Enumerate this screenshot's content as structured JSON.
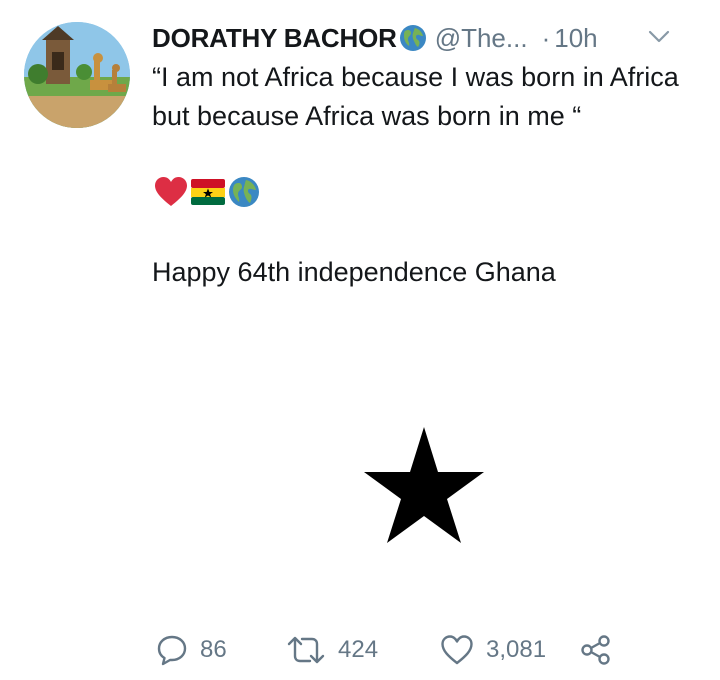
{
  "tweet": {
    "display_name": "DORATHY BACHOR",
    "name_emoji": "globe-icon",
    "handle": "@The...",
    "separator": "·",
    "time": "10h",
    "text": "“I am not Africa because I was born in Africa but because Africa was born in me “",
    "emojis": [
      "heart-icon",
      "ghana-flag-icon",
      "globe-icon"
    ],
    "caption": "Happy 64th independence Ghana"
  },
  "media": {
    "description_colors": {
      "red": "#ce1126",
      "yellow": "#fcd116",
      "green": "#006b3f",
      "star": "#000000"
    }
  },
  "actions": {
    "reply_count": "86",
    "retweet_count": "424",
    "like_count": "3,081"
  },
  "colors": {
    "text": "#14171a",
    "secondary": "#657786"
  }
}
